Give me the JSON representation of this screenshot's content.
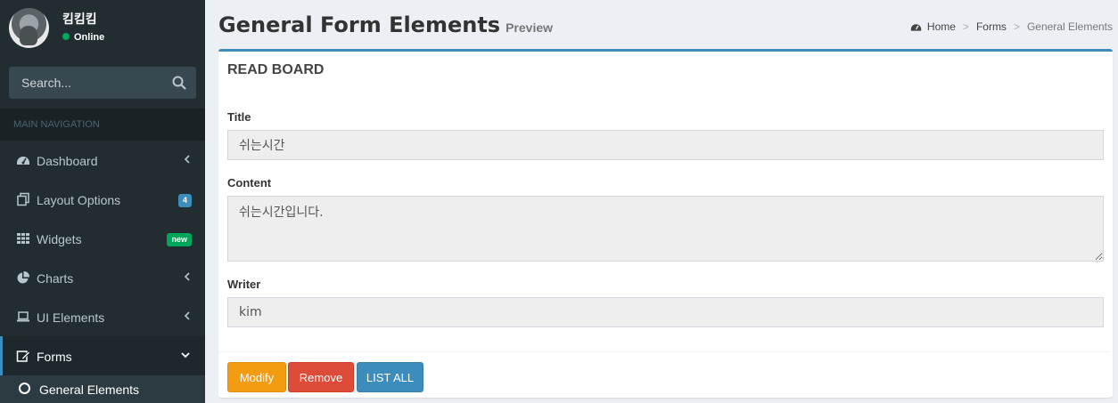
{
  "user": {
    "name": "킴킴킴",
    "status": "Online"
  },
  "search": {
    "placeholder": "Search..."
  },
  "nav_header": "MAIN NAVIGATION",
  "menu": [
    {
      "label": "Dashboard",
      "icon": "dashboard-icon",
      "right": "chevron-left"
    },
    {
      "label": "Layout Options",
      "icon": "files-icon",
      "badge": "4",
      "badge_color": "#3c8dbc"
    },
    {
      "label": "Widgets",
      "icon": "grid-icon",
      "badge": "new",
      "badge_color": "#00a65a"
    },
    {
      "label": "Charts",
      "icon": "pie-chart-icon",
      "right": "chevron-left"
    },
    {
      "label": "UI Elements",
      "icon": "laptop-icon",
      "right": "chevron-left"
    },
    {
      "label": "Forms",
      "icon": "edit-icon",
      "right": "chevron-down",
      "active": true
    }
  ],
  "submenu": {
    "label": "General Elements",
    "icon": "circle-icon"
  },
  "header": {
    "title": "General Form Elements",
    "subtitle": "Preview"
  },
  "breadcrumb": {
    "home": "Home",
    "forms": "Forms",
    "current": "General Elements"
  },
  "box": {
    "title": "READ BOARD",
    "title_label": "Title",
    "title_value": "쉬는시간",
    "content_label": "Content",
    "content_value": "쉬는시간입니다.",
    "writer_label": "Writer",
    "writer_value": "kim"
  },
  "buttons": {
    "modify": "Modify",
    "remove": "Remove",
    "list": "LIST ALL"
  },
  "colors": {
    "sidebar": "#222d32",
    "accent": "#3c8dbc",
    "warning": "#f39c12",
    "danger": "#dd4b39",
    "success": "#00a65a"
  }
}
